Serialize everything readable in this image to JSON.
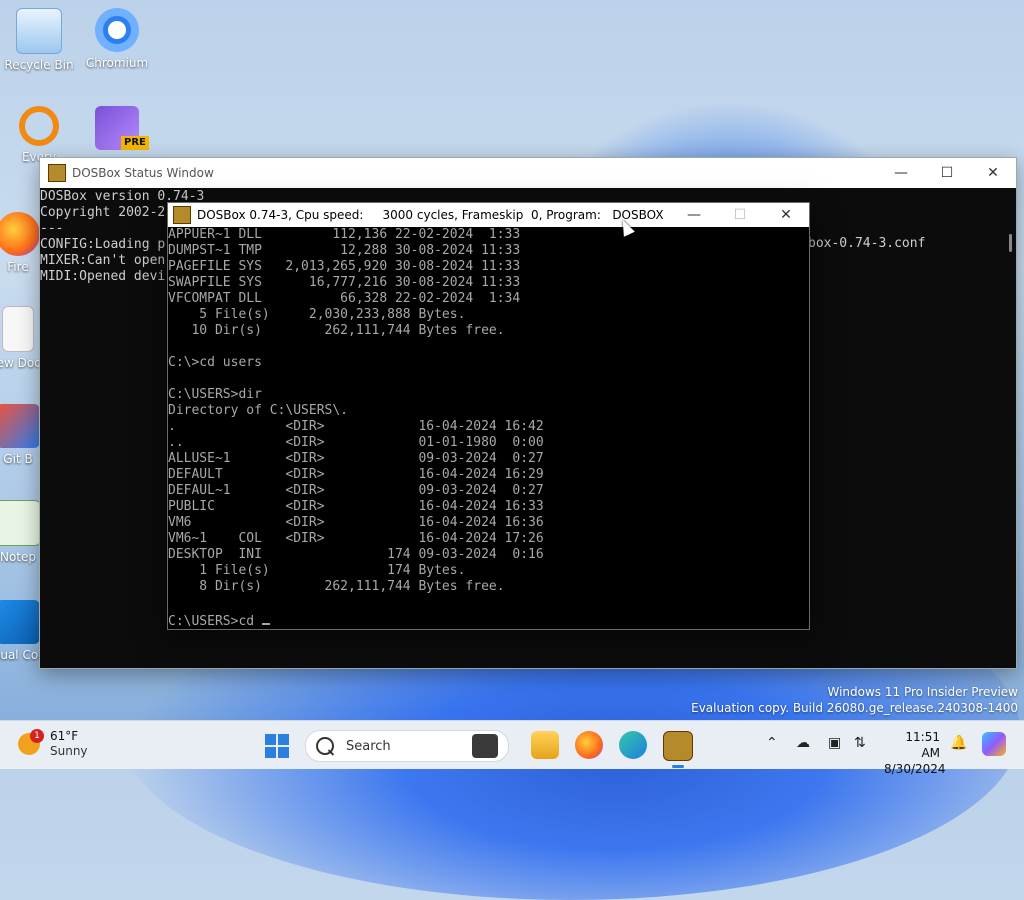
{
  "desktop": {
    "icons": [
      {
        "label": "Recycle Bin"
      },
      {
        "label": "Chromium"
      },
      {
        "label": "Every"
      },
      {
        "label": "PRE"
      },
      {
        "label": "Fire"
      },
      {
        "label": "New Docu"
      },
      {
        "label": "Git B"
      },
      {
        "label": "Notep"
      },
      {
        "label": "Visual Code"
      }
    ]
  },
  "status_window": {
    "title": "DOSBox Status Window",
    "lines": [
      "DOSBox version 0.74-3",
      "Copyright 2002-2",
      "---",
      "CONFIG:Loading p",
      "MIXER:Can't open",
      "MIDI:Opened devi"
    ],
    "right_fragment": "box-0.74-3.conf"
  },
  "dosbox_window": {
    "title": "DOSBox 0.74-3, Cpu speed:     3000 cycles, Frameskip  0, Program:   DOSBOX",
    "lines": [
      "APPUER~1 DLL         112,136 22-02-2024  1:33",
      "DUMPST~1 TMP          12,288 30-08-2024 11:33",
      "PAGEFILE SYS   2,013,265,920 30-08-2024 11:33",
      "SWAPFILE SYS      16,777,216 30-08-2024 11:33",
      "VFCOMPAT DLL          66,328 22-02-2024  1:34",
      "    5 File(s)     2,030,233,888 Bytes.",
      "   10 Dir(s)        262,111,744 Bytes free.",
      "",
      "C:\\>cd users",
      "",
      "C:\\USERS>dir",
      "Directory of C:\\USERS\\.",
      ".              <DIR>            16-04-2024 16:42",
      "..             <DIR>            01-01-1980  0:00",
      "ALLUSE~1       <DIR>            09-03-2024  0:27",
      "DEFAULT        <DIR>            16-04-2024 16:29",
      "DEFAUL~1       <DIR>            09-03-2024  0:27",
      "PUBLIC         <DIR>            16-04-2024 16:33",
      "VM6            <DIR>            16-04-2024 16:36",
      "VM6~1    COL   <DIR>            16-04-2024 17:26",
      "DESKTOP  INI                174 09-03-2024  0:16",
      "    1 File(s)               174 Bytes.",
      "    8 Dir(s)        262,111,744 Bytes free.",
      ""
    ],
    "prompt": "C:\\USERS>cd "
  },
  "watermark": {
    "line1": "Windows 11 Pro Insider Preview",
    "line2": "Evaluation copy. Build 26080.ge_release.240308-1400"
  },
  "taskbar": {
    "weather_temp": "61°F",
    "weather_desc": "Sunny",
    "weather_badge": "1",
    "search_placeholder": "Search",
    "clock_time": "11:51 AM",
    "clock_date": "8/30/2024"
  }
}
